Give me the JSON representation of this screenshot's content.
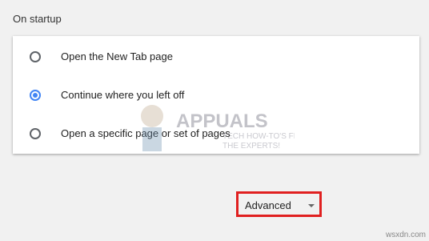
{
  "section": {
    "title": "On startup"
  },
  "options": [
    {
      "label": "Open the New Tab page",
      "selected": false
    },
    {
      "label": "Continue where you left off",
      "selected": true
    },
    {
      "label": "Open a specific page or set of pages",
      "selected": false
    }
  ],
  "advanced": {
    "label": "Advanced",
    "icon": "dropdown-arrow-icon"
  },
  "watermark": {
    "brand": "APPUALS",
    "tagline1": "TECH HOW-TO'S FROM",
    "tagline2": "THE EXPERTS!"
  },
  "corner_mark": "wsxdn.com",
  "colors": {
    "accent": "#4285f4",
    "highlight_border": "#e02020",
    "background": "#f1f1f1"
  }
}
